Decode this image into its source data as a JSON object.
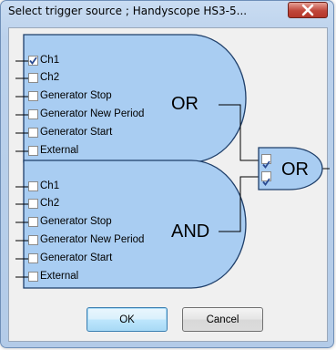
{
  "window": {
    "title": "Select trigger source ; Handyscope HS3-5..."
  },
  "or_gate": {
    "label": "OR",
    "inputs": [
      {
        "label": "Ch1",
        "checked": true
      },
      {
        "label": "Ch2",
        "checked": false
      },
      {
        "label": "Generator Stop",
        "checked": false
      },
      {
        "label": "Generator New Period",
        "checked": false
      },
      {
        "label": "Generator Start",
        "checked": false
      },
      {
        "label": "External",
        "checked": false
      }
    ]
  },
  "and_gate": {
    "label": "AND",
    "inputs": [
      {
        "label": "Ch1",
        "checked": false
      },
      {
        "label": "Ch2",
        "checked": false
      },
      {
        "label": "Generator Stop",
        "checked": false
      },
      {
        "label": "Generator New Period",
        "checked": false
      },
      {
        "label": "Generator Start",
        "checked": false
      },
      {
        "label": "External",
        "checked": false
      }
    ]
  },
  "final_gate": {
    "label": "OR",
    "inputs": [
      {
        "checked": true
      },
      {
        "checked": true
      }
    ]
  },
  "buttons": {
    "ok": "OK",
    "cancel": "Cancel"
  },
  "colors": {
    "gate_fill": "#a9cdf2",
    "gate_stroke": "#1f3f6a",
    "check": "#2b4b91",
    "close": "#c0463a"
  },
  "icons": {
    "close": "close-icon",
    "check": "checkmark-icon"
  }
}
